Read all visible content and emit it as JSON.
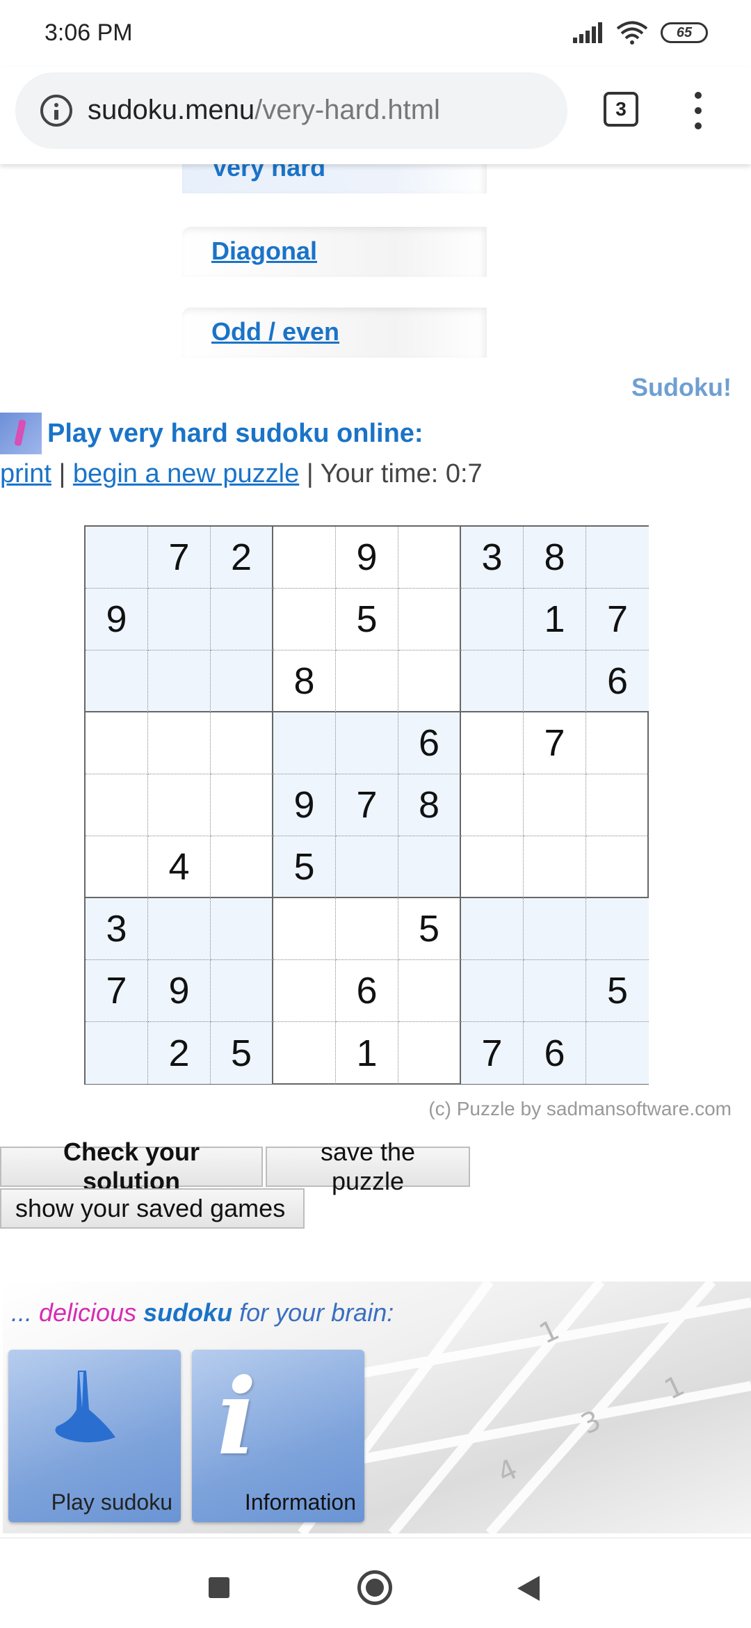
{
  "status_bar": {
    "time": "3:06 PM",
    "battery": "65"
  },
  "browser": {
    "url_host": "sudoku.menu",
    "url_path": "/very-hard.html",
    "tab_count": "3"
  },
  "nav_tabs": [
    {
      "label": "Very hard"
    },
    {
      "label": "Diagonal"
    },
    {
      "label": "Odd / even"
    }
  ],
  "sudoku_tag": "Sudoku!",
  "heading": "Play very hard sudoku online:",
  "links": {
    "print": "print",
    "sep1": " | ",
    "new_puzzle": "begin a new puzzle",
    "sep2": " | ",
    "timer": "Your time: 0:7"
  },
  "grid": [
    [
      "",
      "7",
      "2",
      "",
      "9",
      "",
      "3",
      "8",
      ""
    ],
    [
      "9",
      "",
      "",
      "",
      "5",
      "",
      "",
      "1",
      "7"
    ],
    [
      "",
      "",
      "",
      "8",
      "",
      "",
      "",
      "",
      "6"
    ],
    [
      "",
      "",
      "",
      "",
      "",
      "6",
      "",
      "7",
      ""
    ],
    [
      "",
      "",
      "",
      "9",
      "7",
      "8",
      "",
      "",
      ""
    ],
    [
      "",
      "4",
      "",
      "5",
      "",
      "",
      "",
      "",
      ""
    ],
    [
      "3",
      "",
      "",
      "",
      "",
      "5",
      "",
      "",
      ""
    ],
    [
      "7",
      "9",
      "",
      "",
      "6",
      "",
      "",
      "",
      "5"
    ],
    [
      "",
      "2",
      "5",
      "",
      "1",
      "",
      "7",
      "6",
      ""
    ]
  ],
  "credit": "(c) Puzzle by sadmansoftware.com",
  "buttons": {
    "check": "Check your solution",
    "save": "save the puzzle",
    "show_saved": "show your saved games"
  },
  "promo": {
    "prefix": "... ",
    "pink": "delicious ",
    "bold": "sudoku",
    "suffix": " for your brain:",
    "tile_play": "Play sudoku",
    "tile_info": "Information"
  },
  "colors": {
    "link": "#1a73c8",
    "cell_shade": "#eef5fd",
    "accent_pink": "#d62bb3"
  }
}
